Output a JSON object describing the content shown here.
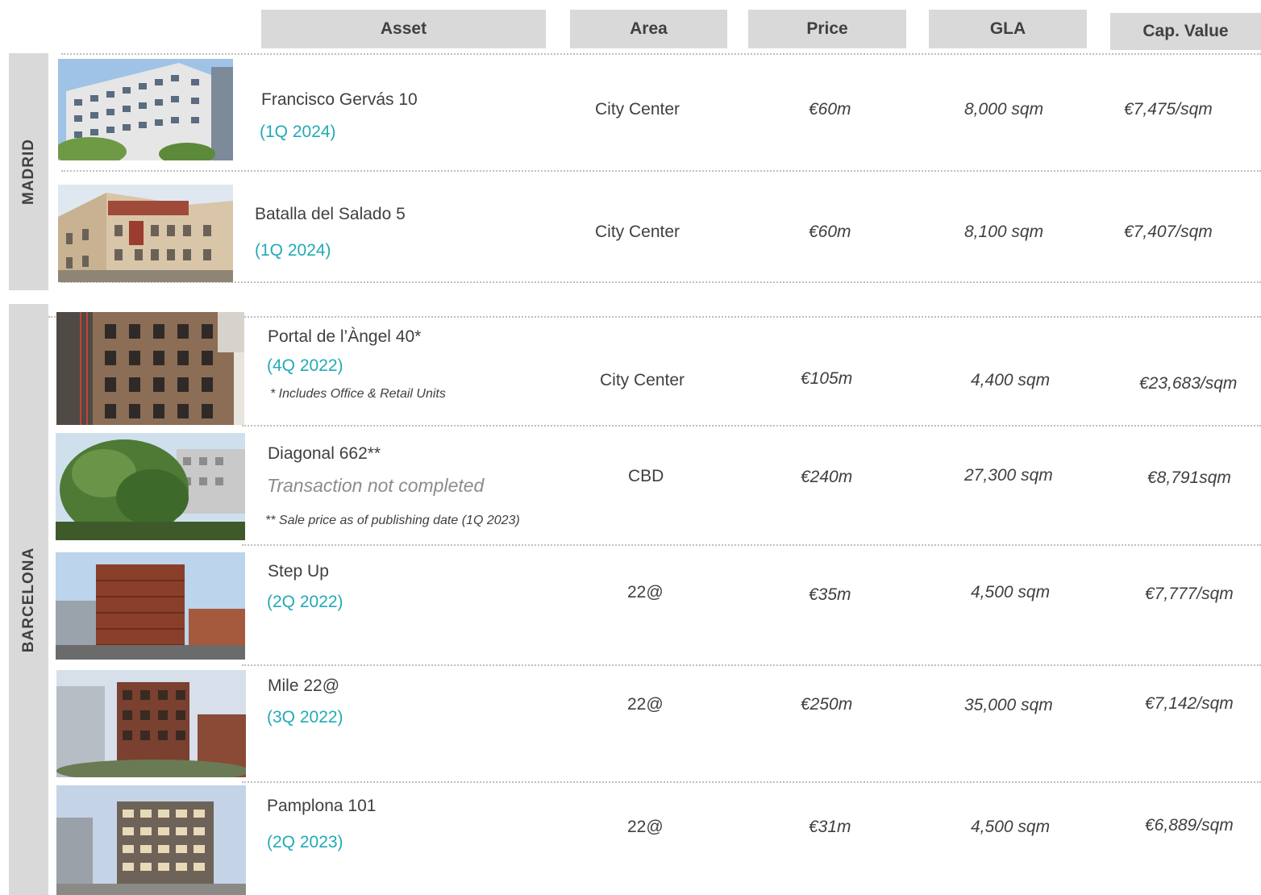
{
  "headers": {
    "asset": "Asset",
    "area": "Area",
    "price": "Price",
    "gla": "GLA",
    "cap_value": "Cap. Value"
  },
  "regions": {
    "madrid": "MADRID",
    "barcelona": "BARCELONA"
  },
  "rows": [
    {
      "asset": "Francisco Gervás 10",
      "date": "(1Q 2024)",
      "area": "City Center",
      "price": "€60m",
      "gla": "8,000 sqm",
      "cap_value": "€7,475/sqm",
      "photo_icon": "office-building-photo"
    },
    {
      "asset": "Batalla del Salado 5",
      "date": "(1Q 2024)",
      "area": "City Center",
      "price": "€60m",
      "gla": "8,100 sqm",
      "cap_value": "€7,407/sqm",
      "photo_icon": "office-building-photo"
    },
    {
      "asset": "Portal de l’Àngel 40*",
      "date": "(4Q 2022)",
      "note": "* Includes Office & Retail Units",
      "area": "City Center",
      "price": "€105m",
      "gla": "4,400 sqm",
      "cap_value": "€23,683/sqm",
      "photo_icon": "office-building-photo"
    },
    {
      "asset": "Diagonal 662**",
      "status": "Transaction not completed",
      "note": "** Sale price as of publishing date (1Q 2023)",
      "area": "CBD",
      "price": "€240m",
      "gla": "27,300 sqm",
      "cap_value": "€8,791sqm",
      "photo_icon": "office-building-photo"
    },
    {
      "asset": "Step Up",
      "date": "(2Q 2022)",
      "area": "22@",
      "price": "€35m",
      "gla": "4,500 sqm",
      "cap_value": "€7,777/sqm",
      "photo_icon": "office-building-photo"
    },
    {
      "asset": "Mile 22@",
      "date": "(3Q 2022)",
      "area": "22@",
      "price": "€250m",
      "gla": "35,000 sqm",
      "cap_value": "€7,142/sqm",
      "photo_icon": "office-building-photo"
    },
    {
      "asset": "Pamplona 101",
      "date": "(2Q 2023)",
      "area": "22@",
      "price": "€31m",
      "gla": "4,500 sqm",
      "cap_value": "€6,889/sqm",
      "photo_icon": "office-building-photo"
    }
  ],
  "colors": {
    "header_bg": "#d9d9d9",
    "text": "#404040",
    "date_accent": "#22aab5",
    "status_gray": "#8c8c8c",
    "separator": "#bfbfbf"
  }
}
